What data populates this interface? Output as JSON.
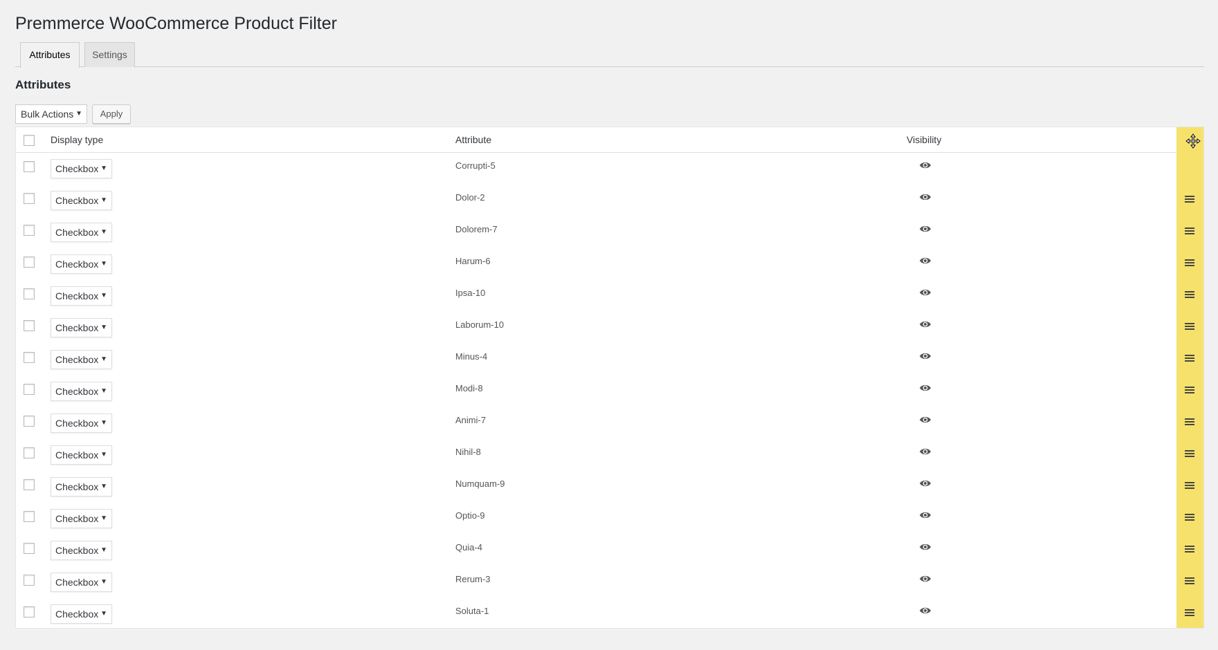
{
  "page": {
    "title": "Premmerce WooCommerce Product Filter"
  },
  "tabs": [
    {
      "label": "Attributes",
      "active": true
    },
    {
      "label": "Settings",
      "active": false
    }
  ],
  "section": {
    "title": "Attributes"
  },
  "bulk": {
    "selected": "Bulk Actions",
    "apply_label": "Apply"
  },
  "table": {
    "columns": {
      "display_type": "Display type",
      "attribute": "Attribute",
      "visibility": "Visibility"
    },
    "rows": [
      {
        "display_type": "Checkbox",
        "attribute": "Corrupti-5",
        "visible": true
      },
      {
        "display_type": "Checkbox",
        "attribute": "Dolor-2",
        "visible": true
      },
      {
        "display_type": "Checkbox",
        "attribute": "Dolorem-7",
        "visible": true
      },
      {
        "display_type": "Checkbox",
        "attribute": "Harum-6",
        "visible": true
      },
      {
        "display_type": "Checkbox",
        "attribute": "Ipsa-10",
        "visible": true
      },
      {
        "display_type": "Checkbox",
        "attribute": "Laborum-10",
        "visible": true
      },
      {
        "display_type": "Checkbox",
        "attribute": "Minus-4",
        "visible": true
      },
      {
        "display_type": "Checkbox",
        "attribute": "Modi-8",
        "visible": true
      },
      {
        "display_type": "Checkbox",
        "attribute": "Animi-7",
        "visible": true
      },
      {
        "display_type": "Checkbox",
        "attribute": "Nihil-8",
        "visible": true
      },
      {
        "display_type": "Checkbox",
        "attribute": "Numquam-9",
        "visible": true
      },
      {
        "display_type": "Checkbox",
        "attribute": "Optio-9",
        "visible": true
      },
      {
        "display_type": "Checkbox",
        "attribute": "Quia-4",
        "visible": true
      },
      {
        "display_type": "Checkbox",
        "attribute": "Rerum-3",
        "visible": true
      },
      {
        "display_type": "Checkbox",
        "attribute": "Soluta-1",
        "visible": true
      }
    ]
  },
  "icons": {
    "visibility": "eye-icon",
    "drag": "drag-handle-icon",
    "cursor": "move-cursor-icon",
    "dropdown": "caret-down-icon"
  },
  "colors": {
    "drag_column": "#f6e16c",
    "background": "#f1f1f1"
  }
}
